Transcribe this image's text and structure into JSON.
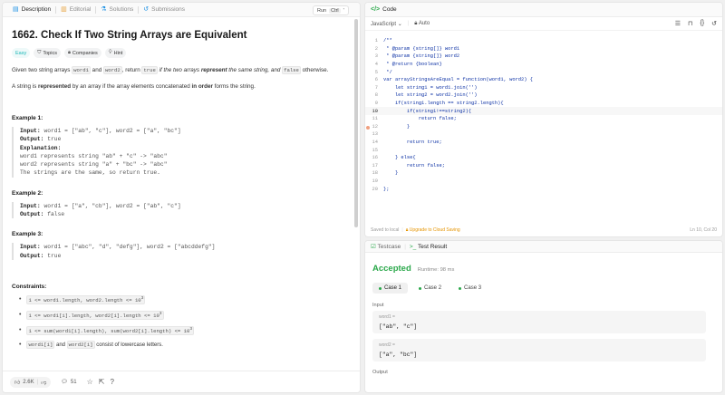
{
  "left_tabs": [
    {
      "label": "Description",
      "icon": "document-icon",
      "active": true
    },
    {
      "label": "Editorial",
      "icon": "book-icon",
      "active": false
    },
    {
      "label": "Solutions",
      "icon": "flask-icon",
      "active": false
    },
    {
      "label": "Submissions",
      "icon": "history-icon",
      "active": false
    }
  ],
  "run_float": {
    "label": "Run",
    "kbd": "Ctrl",
    "extra": "'"
  },
  "problem": {
    "title": "1662. Check If Two String Arrays are Equivalent",
    "difficulty": "Easy",
    "tags": [
      "Topics",
      "Companies",
      "Hint"
    ],
    "desc1_a": "Given two string arrays ",
    "desc1_w1": "word1",
    "desc1_and": " and ",
    "desc1_w2": "word2",
    "desc1_ret": ", return ",
    "desc1_true": "true",
    "desc1_if": " if the two arrays ",
    "desc1_rep": "represent",
    "desc1_same": " the same string, and ",
    "desc1_false": "false",
    "desc1_end": " otherwise.",
    "desc2_a": "A string is ",
    "desc2_rep": "represented",
    "desc2_b": " by an array if the array elements concatenated ",
    "desc2_order": "in order",
    "desc2_c": " forms the string."
  },
  "examples": [
    {
      "title": "Example 1:",
      "input": "word1 = [\"ab\", \"c\"], word2 = [\"a\", \"bc\"]",
      "output": "true",
      "explanation_lines": [
        "word1 represents string \"ab\" + \"c\" -> \"abc\"",
        "word2 represents string \"a\" + \"bc\" -> \"abc\"",
        "The strings are the same, so return true."
      ]
    },
    {
      "title": "Example 2:",
      "input": "word1 = [\"a\", \"cb\"], word2 = [\"ab\", \"c\"]",
      "output": "false"
    },
    {
      "title": "Example 3:",
      "input": "word1  = [\"abc\", \"d\", \"defg\"], word2 = [\"abcddefg\"]",
      "output": "true"
    }
  ],
  "labels": {
    "input": "Input:",
    "output": "Output:",
    "explanation": "Explanation:"
  },
  "constraints": {
    "title": "Constraints:",
    "items": [
      {
        "code": "1 <= word1.length, word2.length <= 10",
        "sup": "3",
        "text": ""
      },
      {
        "code": "1 <= word1[i].length, word2[i].length <= 10",
        "sup": "3",
        "text": ""
      },
      {
        "code": "1 <= sum(word1[i].length), sum(word2[i].length) <= 10",
        "sup": "3",
        "text": ""
      },
      {
        "code": "word1[i]",
        "mid": " and ",
        "code2": "word2[i]",
        "text": " consist of lowercase letters."
      }
    ]
  },
  "footer": {
    "likes": "2.6K",
    "comments": "51"
  },
  "code_panel": {
    "title": "Code",
    "language": "JavaScript",
    "auto": "Auto",
    "lines": [
      "/**",
      " * @param {string[]} word1",
      " * @param {string[]} word2",
      " * @return {boolean}",
      " */",
      "var arrayStringsAreEqual = function(word1, word2) {",
      "    let string1 = word1.join('')",
      "    let string2 = word2.join('')",
      "    if(string1.length == string2.length){",
      "        if(string1!==string2){",
      "            return false;",
      "        }",
      "",
      "        return true;",
      "",
      "    } else{",
      "        return false;",
      "    }",
      "",
      "};"
    ],
    "current_line": 10,
    "breakpoint_line": 12,
    "saved_text": "Saved to local",
    "upgrade_text": "Upgrade to Cloud Saving",
    "cursor_pos": "Ln 10, Col 20"
  },
  "result_panel": {
    "tab1": "Testcase",
    "tab2": "Test Result",
    "status": "Accepted",
    "runtime": "Runtime: 98 ms",
    "cases": [
      "Case 1",
      "Case 2",
      "Case 3"
    ],
    "input_label": "Input",
    "inputs": [
      {
        "name": "word1 =",
        "value": "[\"ab\", \"c\"]"
      },
      {
        "name": "word2 =",
        "value": "[\"a\", \"bc\"]"
      }
    ],
    "output_label": "Output"
  }
}
